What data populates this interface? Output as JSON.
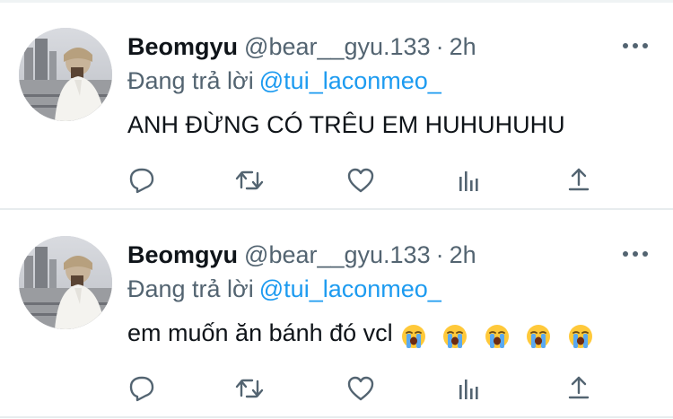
{
  "colors": {
    "primary_text": "#0f1419",
    "secondary_text": "#536471",
    "link": "#1d9bf0",
    "divider": "#e7ecee",
    "icon": "#536471",
    "emoji_face": "#ffc93a",
    "emoji_tear": "#5aa9f0"
  },
  "tweets": [
    {
      "display_name": "Beomgyu",
      "handle": "@bear__gyu.133",
      "separator": "·",
      "time": "2h",
      "reply_prefix": "Đang trả lời",
      "reply_to": "@tui_laconmeo_",
      "text": "ANH ĐỪNG CÓ TRÊU EM HUHUHUHU",
      "emoji": [],
      "actions": [
        "reply-icon",
        "retweet-icon",
        "like-icon",
        "views-icon",
        "share-icon"
      ]
    },
    {
      "display_name": "Beomgyu",
      "handle": "@bear__gyu.133",
      "separator": "·",
      "time": "2h",
      "reply_prefix": "Đang trả lời",
      "reply_to": "@tui_laconmeo_",
      "text": "em muốn ăn bánh đó vcl",
      "emoji": [
        "loudly-crying-face",
        "loudly-crying-face",
        "loudly-crying-face",
        "loudly-crying-face",
        "loudly-crying-face"
      ],
      "actions": [
        "reply-icon",
        "retweet-icon",
        "like-icon",
        "views-icon",
        "share-icon"
      ]
    }
  ]
}
